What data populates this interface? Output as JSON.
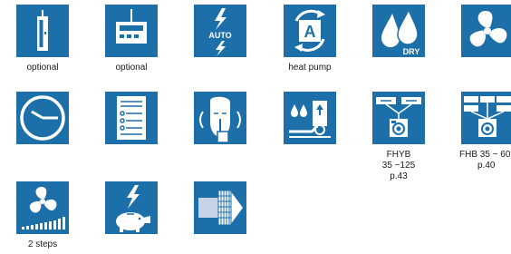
{
  "colors": {
    "tile_blue": "#1d6fa9",
    "icon_white": "#ffffff",
    "caption_text": "#1a1a1a"
  },
  "icons": [
    {
      "name": "wall-switch-icon",
      "caption": [
        "optional"
      ]
    },
    {
      "name": "wired-remote-controller-icon",
      "caption": [
        "optional"
      ]
    },
    {
      "name": "auto-mode-icon",
      "label": "AUTO"
    },
    {
      "name": "heat-pump-icon",
      "label": "A",
      "caption": [
        "heat pump"
      ]
    },
    {
      "name": "dry-mode-icon",
      "label": "DRY"
    },
    {
      "name": "fan-icon"
    },
    {
      "name": "clock-timer-icon"
    },
    {
      "name": "settings-list-icon"
    },
    {
      "name": "quiet-operation-icon"
    },
    {
      "name": "drain-pump-icon"
    },
    {
      "name": "fhyb-unit-icon",
      "caption": [
        "FHYB",
        "35 ~125",
        "p.43"
      ]
    },
    {
      "name": "fhb-unit-icon",
      "caption": [
        "FHB 35 ~ 60",
        "p.40"
      ]
    },
    {
      "name": "fan-speed-steps-icon",
      "caption": [
        "2 steps"
      ]
    },
    {
      "name": "energy-saving-piggy-icon"
    },
    {
      "name": "air-filter-icon"
    }
  ]
}
